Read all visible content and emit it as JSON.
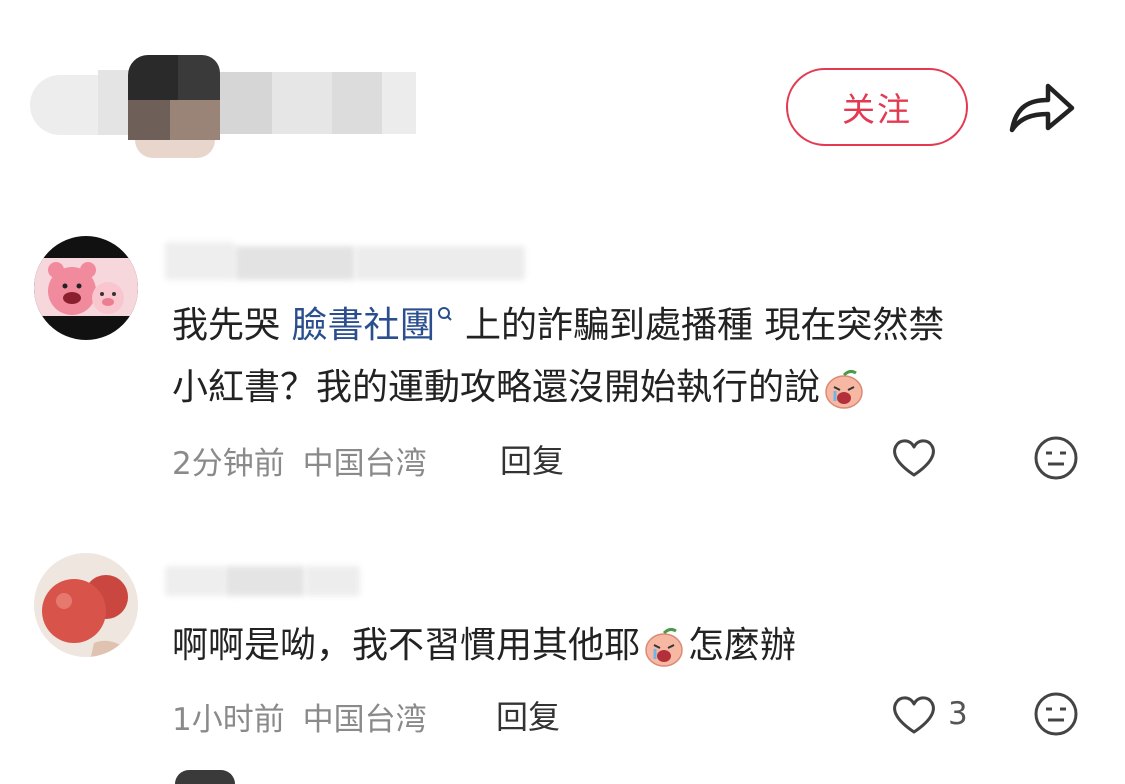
{
  "header": {
    "follow_label": "关注",
    "share_icon": "share-arrow-icon",
    "accent_color": "#e33a52"
  },
  "comments": [
    {
      "avatar_icon": "pink-bear-avatar",
      "text_before_link": "我先哭",
      "link_text": "臉書社團",
      "text_after_link": "上的詐騙到處播種 現在突然禁",
      "line2": "小紅書？我的運動攻略還沒開始執行的說",
      "emoji": "crying-peach-emoji",
      "time": "2分钟前",
      "location": "中国台湾",
      "reply_label": "回复",
      "like_count": ""
    },
    {
      "avatar_icon": "tomato-avatar",
      "text_before_emoji": "啊啊是呦，我不習慣用其他耶",
      "text_after_emoji": "怎麼辦",
      "emoji": "crying-peach-emoji",
      "time": "1小时前",
      "location": "中国台湾",
      "reply_label": "回复",
      "like_count": "3"
    }
  ]
}
